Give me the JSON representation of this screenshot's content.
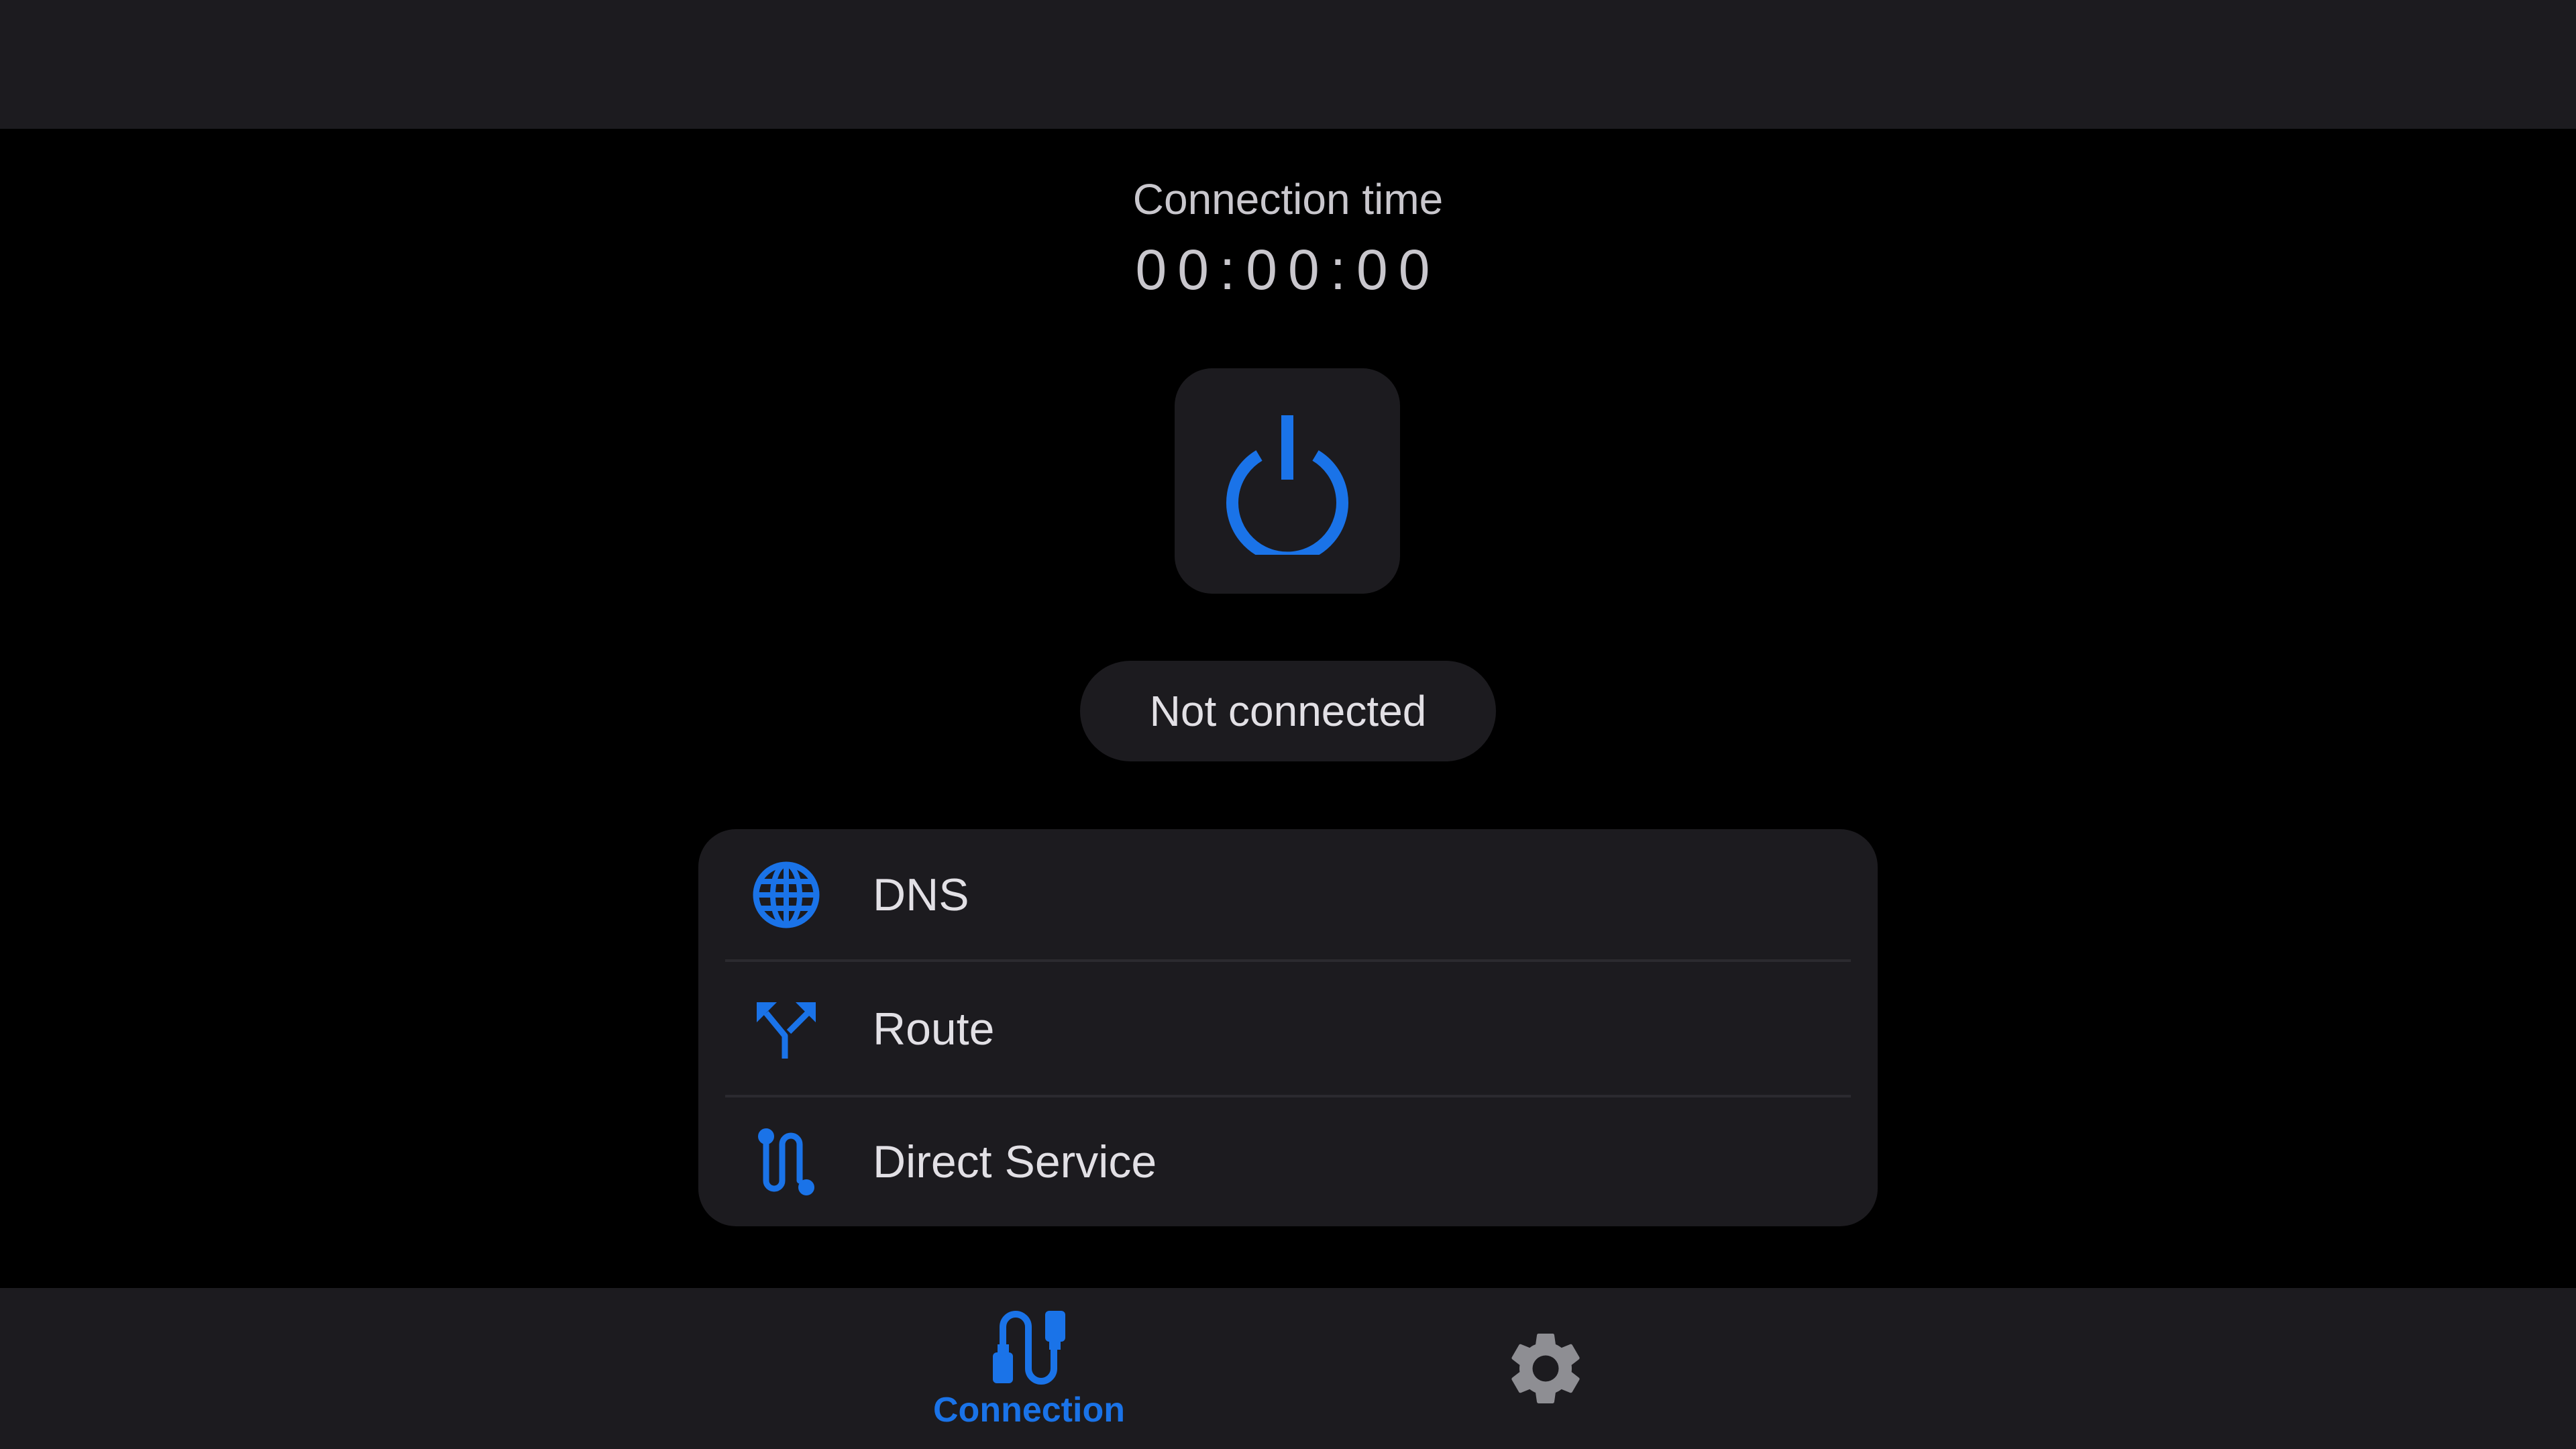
{
  "connection": {
    "time_label": "Connection time",
    "time_value": "00:00:00",
    "status": "Not connected"
  },
  "options": [
    {
      "label": "DNS",
      "icon": "globe-icon"
    },
    {
      "label": "Route",
      "icon": "route-fork-icon"
    },
    {
      "label": "Direct Service",
      "icon": "direct-path-icon"
    }
  ],
  "nav": {
    "connection_label": "Connection",
    "connection_icon": "cable-connection-icon",
    "settings_icon": "gear-icon"
  },
  "colors": {
    "accent": "#1a73e8",
    "surface": "#1c1b1f",
    "background": "#000000",
    "text": "#e2e0e5",
    "inactive_icon": "#8e8e93"
  }
}
